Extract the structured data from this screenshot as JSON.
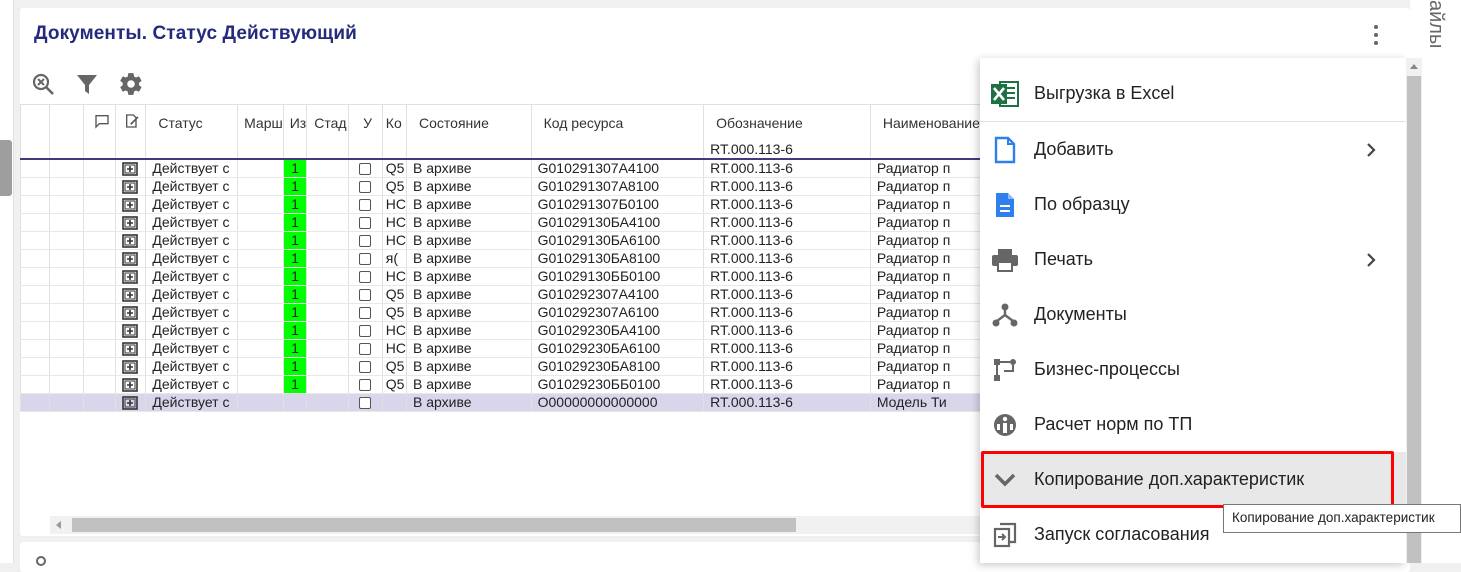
{
  "panel": {
    "title": "Документы. Статус Действующий"
  },
  "side": {
    "files_label": "айлы"
  },
  "grid": {
    "headers": [
      "",
      "",
      "",
      "",
      "Статус",
      "Марш",
      "Из",
      "Стад",
      "У",
      "Ко",
      "Состояние",
      "Код ресурса",
      "Обозначение",
      "Наименование"
    ],
    "filter_designation": "RT.000.113-6",
    "rows": [
      {
        "status": "Действует с",
        "flag": "1",
        "ko": "Q5",
        "state": "В архиве",
        "code": "G010291307A4100",
        "designation": "RT.000.113-6",
        "name": "Радиатор п"
      },
      {
        "status": "Действует с",
        "flag": "1",
        "ko": "Q5",
        "state": "В архиве",
        "code": "G010291307A8100",
        "designation": "RT.000.113-6",
        "name": "Радиатор п"
      },
      {
        "status": "Действует с",
        "flag": "1",
        "ko": "НС",
        "state": "В архиве",
        "code": "G010291307Б0100",
        "designation": "RT.000.113-6",
        "name": "Радиатор п"
      },
      {
        "status": "Действует с",
        "flag": "1",
        "ko": "НС",
        "state": "В архиве",
        "code": "G01029130БА4100",
        "designation": "RT.000.113-6",
        "name": "Радиатор п"
      },
      {
        "status": "Действует с",
        "flag": "1",
        "ko": "НС",
        "state": "В архиве",
        "code": "G01029130БА6100",
        "designation": "RT.000.113-6",
        "name": "Радиатор п"
      },
      {
        "status": "Действует с",
        "flag": "1",
        "ko": "я(",
        "state": "В архиве",
        "code": "G01029130БА8100",
        "designation": "RT.000.113-6",
        "name": "Радиатор п"
      },
      {
        "status": "Действует с",
        "flag": "1",
        "ko": "НС",
        "state": "В архиве",
        "code": "G01029130ББ0100",
        "designation": "RT.000.113-6",
        "name": "Радиатор п"
      },
      {
        "status": "Действует с",
        "flag": "1",
        "ko": "Q5",
        "state": "В архиве",
        "code": "G010292307A4100",
        "designation": "RT.000.113-6",
        "name": "Радиатор п"
      },
      {
        "status": "Действует с",
        "flag": "1",
        "ko": "Q5",
        "state": "В архиве",
        "code": "G010292307A6100",
        "designation": "RT.000.113-6",
        "name": "Радиатор п"
      },
      {
        "status": "Действует с",
        "flag": "1",
        "ko": "НС",
        "state": "В архиве",
        "code": "G01029230БА4100",
        "designation": "RT.000.113-6",
        "name": "Радиатор п"
      },
      {
        "status": "Действует с",
        "flag": "1",
        "ko": "НС",
        "state": "В архиве",
        "code": "G01029230БА6100",
        "designation": "RT.000.113-6",
        "name": "Радиатор п"
      },
      {
        "status": "Действует с",
        "flag": "1",
        "ko": "Q5",
        "state": "В архиве",
        "code": "G01029230БА8100",
        "designation": "RT.000.113-6",
        "name": "Радиатор п"
      },
      {
        "status": "Действует с",
        "flag": "1",
        "ko": "Q5",
        "state": "В архиве",
        "code": "G01029230ББ0100",
        "designation": "RT.000.113-6",
        "name": "Радиатор п"
      },
      {
        "status": "Действует с",
        "flag": "",
        "ko": "",
        "state": "В архиве",
        "code": "O00000000000000",
        "designation": "RT.000.113-6",
        "name": "Модель Ти"
      }
    ],
    "flag_color": "#00ff00",
    "selected_row_color": "#d9d6eb"
  },
  "menu": {
    "items": [
      {
        "label": "Выгрузка в Excel",
        "icon": "excel-icon"
      },
      {
        "label": "Добавить",
        "icon": "file-add-icon",
        "submenu": true
      },
      {
        "label": "По образцу",
        "icon": "file-copy-icon"
      },
      {
        "label": "Печать",
        "icon": "printer-icon",
        "submenu": true
      },
      {
        "label": "Документы",
        "icon": "documents-tree-icon"
      },
      {
        "label": "Бизнес-процессы",
        "icon": "workflow-icon"
      },
      {
        "label": "Расчет норм по ТП",
        "icon": "calculation-icon"
      },
      {
        "label": "Копирование доп.характеристик",
        "icon": "chevron-down-icon"
      },
      {
        "label": "Запуск согласования",
        "icon": "start-approval-icon"
      }
    ],
    "highlight_color": "#ff0000"
  },
  "tooltip": {
    "text": "Копирование доп.характеристик"
  },
  "colors": {
    "title": "#252a7c",
    "excel_green": "#1e7145",
    "doc_blue": "#2f80ed"
  }
}
